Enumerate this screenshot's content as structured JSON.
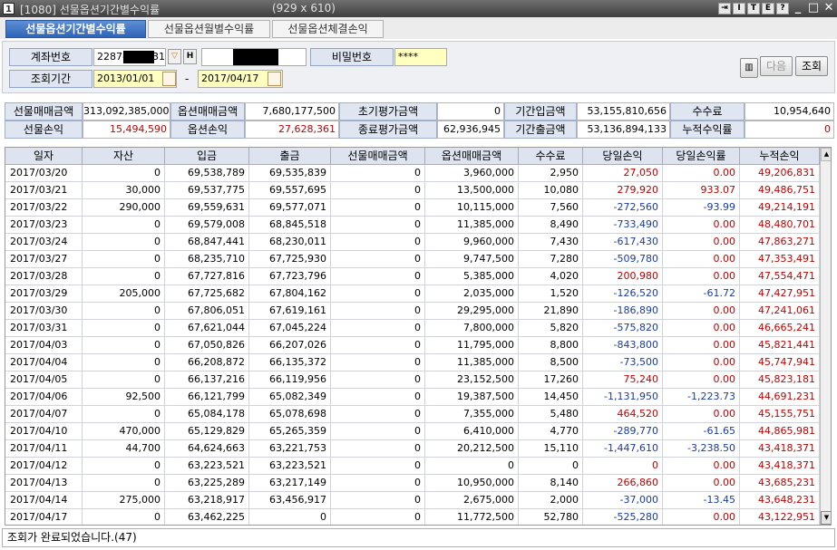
{
  "window": {
    "icon_label": "1",
    "title": "[1080] 선물옵션기간별수익률",
    "size_text": "(929 x 610)",
    "tool_buttons": [
      "I",
      "T",
      "E",
      "?"
    ],
    "controls": [
      "_",
      "□",
      "✕"
    ]
  },
  "tabs": [
    {
      "label": "선물옵션기간별수익률",
      "active": true
    },
    {
      "label": "선물옵션월별수익률",
      "active": false
    },
    {
      "label": "선물옵션체결손익",
      "active": false
    }
  ],
  "query": {
    "account_label": "계좌번호",
    "account_prefix": "2287-",
    "account_suffix": "31",
    "password_label": "비밀번호",
    "password_value": "****",
    "period_label": "조회기간",
    "start_date": "2013/01/01",
    "end_date": "2017/04/17",
    "date_sep": "-",
    "next_button": "다음",
    "search_button": "조회"
  },
  "summary": {
    "row1": [
      {
        "label": "선물매매금액",
        "value": "313,092,385,000",
        "color": ""
      },
      {
        "label": "옵션매매금액",
        "value": "7,680,177,500",
        "color": ""
      },
      {
        "label": "초기평가금액",
        "value": "0",
        "color": ""
      },
      {
        "label": "기간입금액",
        "value": "53,155,810,656",
        "color": ""
      },
      {
        "label": "수수료",
        "value": "10,954,640",
        "color": ""
      }
    ],
    "row2": [
      {
        "label": "선물손익",
        "value": "15,494,590",
        "color": "red"
      },
      {
        "label": "옵션손익",
        "value": "27,628,361",
        "color": "red"
      },
      {
        "label": "종료평가금액",
        "value": "62,936,945",
        "color": ""
      },
      {
        "label": "기간출금액",
        "value": "53,136,894,133",
        "color": ""
      },
      {
        "label": "누적수익률",
        "value": "0",
        "color": "red"
      }
    ]
  },
  "grid": {
    "headers": [
      "일자",
      "자산",
      "입금",
      "출금",
      "선물매매금액",
      "옵션매매금액",
      "수수료",
      "당일손익",
      "당일손익률",
      "누적손익"
    ],
    "rows": [
      {
        "c": [
          "2017/03/20",
          "0",
          "69,538,789",
          "69,535,839",
          "0",
          "3,960,000",
          "2,950",
          "27,050",
          "0.00",
          "49,206,831"
        ],
        "s": [
          "",
          "",
          "",
          "",
          "",
          "",
          "",
          "red",
          "red",
          "red"
        ]
      },
      {
        "c": [
          "2017/03/21",
          "30,000",
          "69,537,775",
          "69,557,695",
          "0",
          "13,500,000",
          "10,080",
          "279,920",
          "933.07",
          "49,486,751"
        ],
        "s": [
          "",
          "",
          "",
          "",
          "",
          "",
          "",
          "red",
          "red",
          "red"
        ]
      },
      {
        "c": [
          "2017/03/22",
          "290,000",
          "69,559,631",
          "69,577,071",
          "0",
          "10,115,000",
          "7,560",
          "-272,560",
          "-93.99",
          "49,214,191"
        ],
        "s": [
          "",
          "",
          "",
          "",
          "",
          "",
          "",
          "blue",
          "blue",
          "red"
        ]
      },
      {
        "c": [
          "2017/03/23",
          "0",
          "69,579,008",
          "68,845,518",
          "0",
          "11,385,000",
          "8,490",
          "-733,490",
          "0.00",
          "48,480,701"
        ],
        "s": [
          "",
          "",
          "",
          "",
          "",
          "",
          "",
          "blue",
          "red",
          "red"
        ]
      },
      {
        "c": [
          "2017/03/24",
          "0",
          "68,847,441",
          "68,230,011",
          "0",
          "9,960,000",
          "7,430",
          "-617,430",
          "0.00",
          "47,863,271"
        ],
        "s": [
          "",
          "",
          "",
          "",
          "",
          "",
          "",
          "blue",
          "red",
          "red"
        ]
      },
      {
        "c": [
          "2017/03/27",
          "0",
          "68,235,710",
          "67,725,930",
          "0",
          "9,747,500",
          "7,280",
          "-509,780",
          "0.00",
          "47,353,491"
        ],
        "s": [
          "",
          "",
          "",
          "",
          "",
          "",
          "",
          "blue",
          "red",
          "red"
        ]
      },
      {
        "c": [
          "2017/03/28",
          "0",
          "67,727,816",
          "67,723,796",
          "0",
          "5,385,000",
          "4,020",
          "200,980",
          "0.00",
          "47,554,471"
        ],
        "s": [
          "",
          "",
          "",
          "",
          "",
          "",
          "",
          "red",
          "red",
          "red"
        ]
      },
      {
        "c": [
          "2017/03/29",
          "205,000",
          "67,725,682",
          "67,804,162",
          "0",
          "2,035,000",
          "1,520",
          "-126,520",
          "-61.72",
          "47,427,951"
        ],
        "s": [
          "",
          "",
          "",
          "",
          "",
          "",
          "",
          "blue",
          "blue",
          "red"
        ]
      },
      {
        "c": [
          "2017/03/30",
          "0",
          "67,806,051",
          "67,619,161",
          "0",
          "29,295,000",
          "21,890",
          "-186,890",
          "0.00",
          "47,241,061"
        ],
        "s": [
          "",
          "",
          "",
          "",
          "",
          "",
          "",
          "blue",
          "red",
          "red"
        ]
      },
      {
        "c": [
          "2017/03/31",
          "0",
          "67,621,044",
          "67,045,224",
          "0",
          "7,800,000",
          "5,820",
          "-575,820",
          "0.00",
          "46,665,241"
        ],
        "s": [
          "",
          "",
          "",
          "",
          "",
          "",
          "",
          "blue",
          "red",
          "red"
        ]
      },
      {
        "c": [
          "2017/04/03",
          "0",
          "67,050,826",
          "66,207,026",
          "0",
          "11,795,000",
          "8,800",
          "-843,800",
          "0.00",
          "45,821,441"
        ],
        "s": [
          "",
          "",
          "",
          "",
          "",
          "",
          "",
          "blue",
          "red",
          "red"
        ]
      },
      {
        "c": [
          "2017/04/04",
          "0",
          "66,208,872",
          "66,135,372",
          "0",
          "11,385,000",
          "8,500",
          "-73,500",
          "0.00",
          "45,747,941"
        ],
        "s": [
          "",
          "",
          "",
          "",
          "",
          "",
          "",
          "blue",
          "red",
          "red"
        ]
      },
      {
        "c": [
          "2017/04/05",
          "0",
          "66,137,216",
          "66,119,956",
          "0",
          "23,152,500",
          "17,260",
          "75,240",
          "0.00",
          "45,823,181"
        ],
        "s": [
          "",
          "",
          "",
          "",
          "",
          "",
          "",
          "red",
          "red",
          "red"
        ]
      },
      {
        "c": [
          "2017/04/06",
          "92,500",
          "66,121,799",
          "65,082,349",
          "0",
          "19,387,500",
          "14,450",
          "-1,131,950",
          "-1,223.73",
          "44,691,231"
        ],
        "s": [
          "",
          "",
          "",
          "",
          "",
          "",
          "",
          "blue",
          "blue",
          "red"
        ]
      },
      {
        "c": [
          "2017/04/07",
          "0",
          "65,084,178",
          "65,078,698",
          "0",
          "7,355,000",
          "5,480",
          "464,520",
          "0.00",
          "45,155,751"
        ],
        "s": [
          "",
          "",
          "",
          "",
          "",
          "",
          "",
          "red",
          "red",
          "red"
        ]
      },
      {
        "c": [
          "2017/04/10",
          "470,000",
          "65,129,829",
          "65,265,359",
          "0",
          "6,410,000",
          "4,770",
          "-289,770",
          "-61.65",
          "44,865,981"
        ],
        "s": [
          "",
          "",
          "",
          "",
          "",
          "",
          "",
          "blue",
          "blue",
          "red"
        ]
      },
      {
        "c": [
          "2017/04/11",
          "44,700",
          "64,624,663",
          "63,221,753",
          "0",
          "20,212,500",
          "15,110",
          "-1,447,610",
          "-3,238.50",
          "43,418,371"
        ],
        "s": [
          "",
          "",
          "",
          "",
          "",
          "",
          "",
          "blue",
          "blue",
          "red"
        ]
      },
      {
        "c": [
          "2017/04/12",
          "0",
          "63,223,521",
          "63,223,521",
          "0",
          "0",
          "0",
          "0",
          "0.00",
          "43,418,371"
        ],
        "s": [
          "",
          "",
          "",
          "",
          "",
          "",
          "",
          "red",
          "red",
          "red"
        ]
      },
      {
        "c": [
          "2017/04/13",
          "0",
          "63,225,289",
          "63,217,149",
          "0",
          "10,950,000",
          "8,140",
          "266,860",
          "0.00",
          "43,685,231"
        ],
        "s": [
          "",
          "",
          "",
          "",
          "",
          "",
          "",
          "red",
          "red",
          "red"
        ]
      },
      {
        "c": [
          "2017/04/14",
          "275,000",
          "63,218,917",
          "63,456,917",
          "0",
          "2,675,000",
          "2,000",
          "-37,000",
          "-13.45",
          "43,648,231"
        ],
        "s": [
          "",
          "",
          "",
          "",
          "",
          "",
          "",
          "blue",
          "blue",
          "red"
        ]
      },
      {
        "c": [
          "2017/04/17",
          "0",
          "63,462,225",
          "0",
          "0",
          "11,772,500",
          "52,780",
          "-525,280",
          "0.00",
          "43,122,951"
        ],
        "s": [
          "",
          "",
          "",
          "",
          "",
          "",
          "",
          "blue",
          "red",
          "red"
        ]
      }
    ]
  },
  "status": {
    "text": "조회가 완료되었습니다.(47)"
  },
  "colors": {
    "red": "#c00000",
    "blue": "#1a3ba8",
    "accent": "#2e64b8"
  }
}
